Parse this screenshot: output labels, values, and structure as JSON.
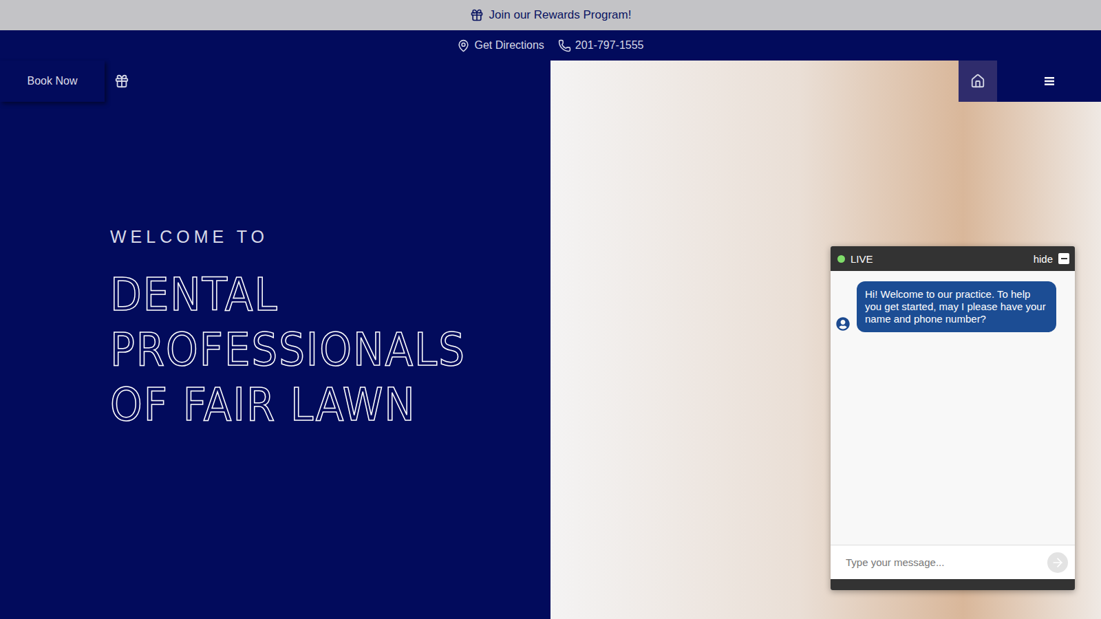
{
  "rewards_bar": {
    "text": "Join our Rewards Program!"
  },
  "info_bar": {
    "directions": "Get Directions",
    "phone": "201-797-1555"
  },
  "header": {
    "book_button": "Book Now"
  },
  "hero": {
    "kicker": "WELCOME TO",
    "title_lines": [
      "DENTAL",
      "PROFESSIONALS",
      "OF FAIR LAWN"
    ]
  },
  "chat": {
    "status": "LIVE",
    "online": true,
    "hide": "hide",
    "messages": [
      {
        "text": "Hi! Welcome to our practice. To help you get started, may I please have your name and phone number?"
      }
    ],
    "input_placeholder": "Type your message..."
  }
}
